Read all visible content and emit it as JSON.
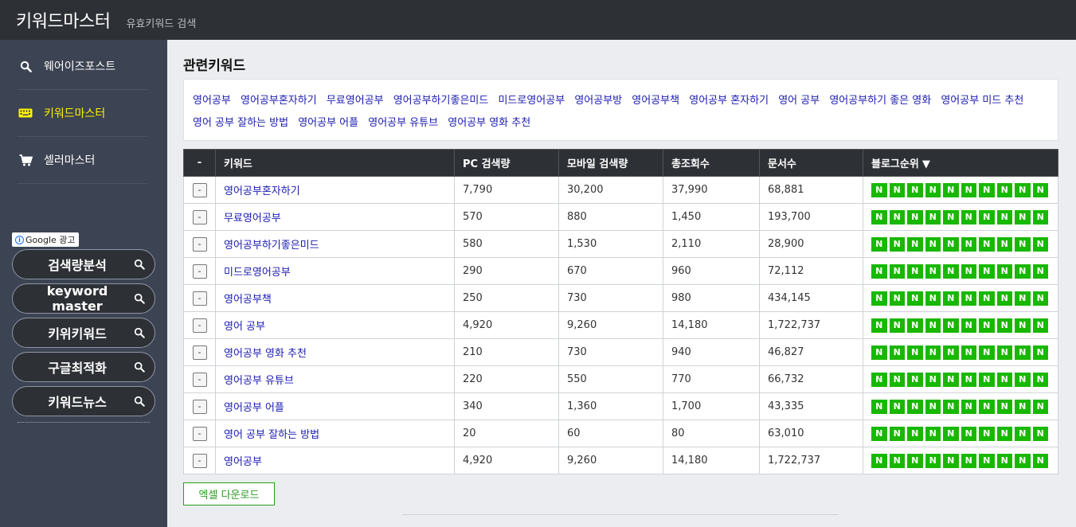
{
  "header": {
    "title": "키워드마스터",
    "subtitle": "유효키워드 검색"
  },
  "sidebar": {
    "items": [
      {
        "label": "웨어이즈포스트",
        "icon": "search-icon"
      },
      {
        "label": "키워드마스터",
        "icon": "keyboard-icon",
        "active": true
      },
      {
        "label": "셀러마스터",
        "icon": "cart-icon"
      }
    ],
    "ad_label": "Google 광고",
    "ad_links": [
      {
        "label": "검색량분석",
        "icon": "search-icon"
      },
      {
        "label": "keyword master",
        "icon": "search-icon"
      },
      {
        "label": "키위키워드",
        "icon": "search-icon"
      },
      {
        "label": "구글최적화",
        "icon": "search-icon"
      },
      {
        "label": "키워드뉴스",
        "icon": "search-icon"
      }
    ]
  },
  "main": {
    "section_title": "관련키워드",
    "related_keywords": [
      "영어공부",
      "영어공부혼자하기",
      "무료영어공부",
      "영어공부하기좋은미드",
      "미드로영어공부",
      "영어공부방",
      "영어공부책",
      "영어공부 혼자하기",
      "영어 공부",
      "영어공부하기 좋은 영화",
      "영어공부 미드 추천",
      "영어 공부 잘하는 방법",
      "영어공부 어플",
      "영어공부 유튜브",
      "영어공부 영화 추천"
    ],
    "table": {
      "headers": [
        "-",
        "키워드",
        "PC 검색량",
        "모바일 검색량",
        "총조회수",
        "문서수",
        "블로그순위"
      ],
      "sort_indicator": "▼",
      "row_button": "-",
      "badge_label": "N",
      "badges_per_row": 10,
      "rows": [
        {
          "keyword": "영어공부혼자하기",
          "pc": "7,790",
          "mobile": "30,200",
          "total": "37,990",
          "docs": "68,881"
        },
        {
          "keyword": "무료영어공부",
          "pc": "570",
          "mobile": "880",
          "total": "1,450",
          "docs": "193,700"
        },
        {
          "keyword": "영어공부하기좋은미드",
          "pc": "580",
          "mobile": "1,530",
          "total": "2,110",
          "docs": "28,900"
        },
        {
          "keyword": "미드로영어공부",
          "pc": "290",
          "mobile": "670",
          "total": "960",
          "docs": "72,112"
        },
        {
          "keyword": "영어공부책",
          "pc": "250",
          "mobile": "730",
          "total": "980",
          "docs": "434,145"
        },
        {
          "keyword": "영어 공부",
          "pc": "4,920",
          "mobile": "9,260",
          "total": "14,180",
          "docs": "1,722,737"
        },
        {
          "keyword": "영어공부 영화 추천",
          "pc": "210",
          "mobile": "730",
          "total": "940",
          "docs": "46,827"
        },
        {
          "keyword": "영어공부 유튜브",
          "pc": "220",
          "mobile": "550",
          "total": "770",
          "docs": "66,732"
        },
        {
          "keyword": "영어공부 어플",
          "pc": "340",
          "mobile": "1,360",
          "total": "1,700",
          "docs": "43,335"
        },
        {
          "keyword": "영어 공부 잘하는 방법",
          "pc": "20",
          "mobile": "60",
          "total": "80",
          "docs": "63,010"
        },
        {
          "keyword": "영어공부",
          "pc": "4,920",
          "mobile": "9,260",
          "total": "14,180",
          "docs": "1,722,737"
        }
      ]
    },
    "excel_button": "엑셀 다운로드"
  },
  "colors": {
    "accent_green": "#19b800",
    "active_nav": "#fff200",
    "link_blue": "#1a1ab0"
  }
}
